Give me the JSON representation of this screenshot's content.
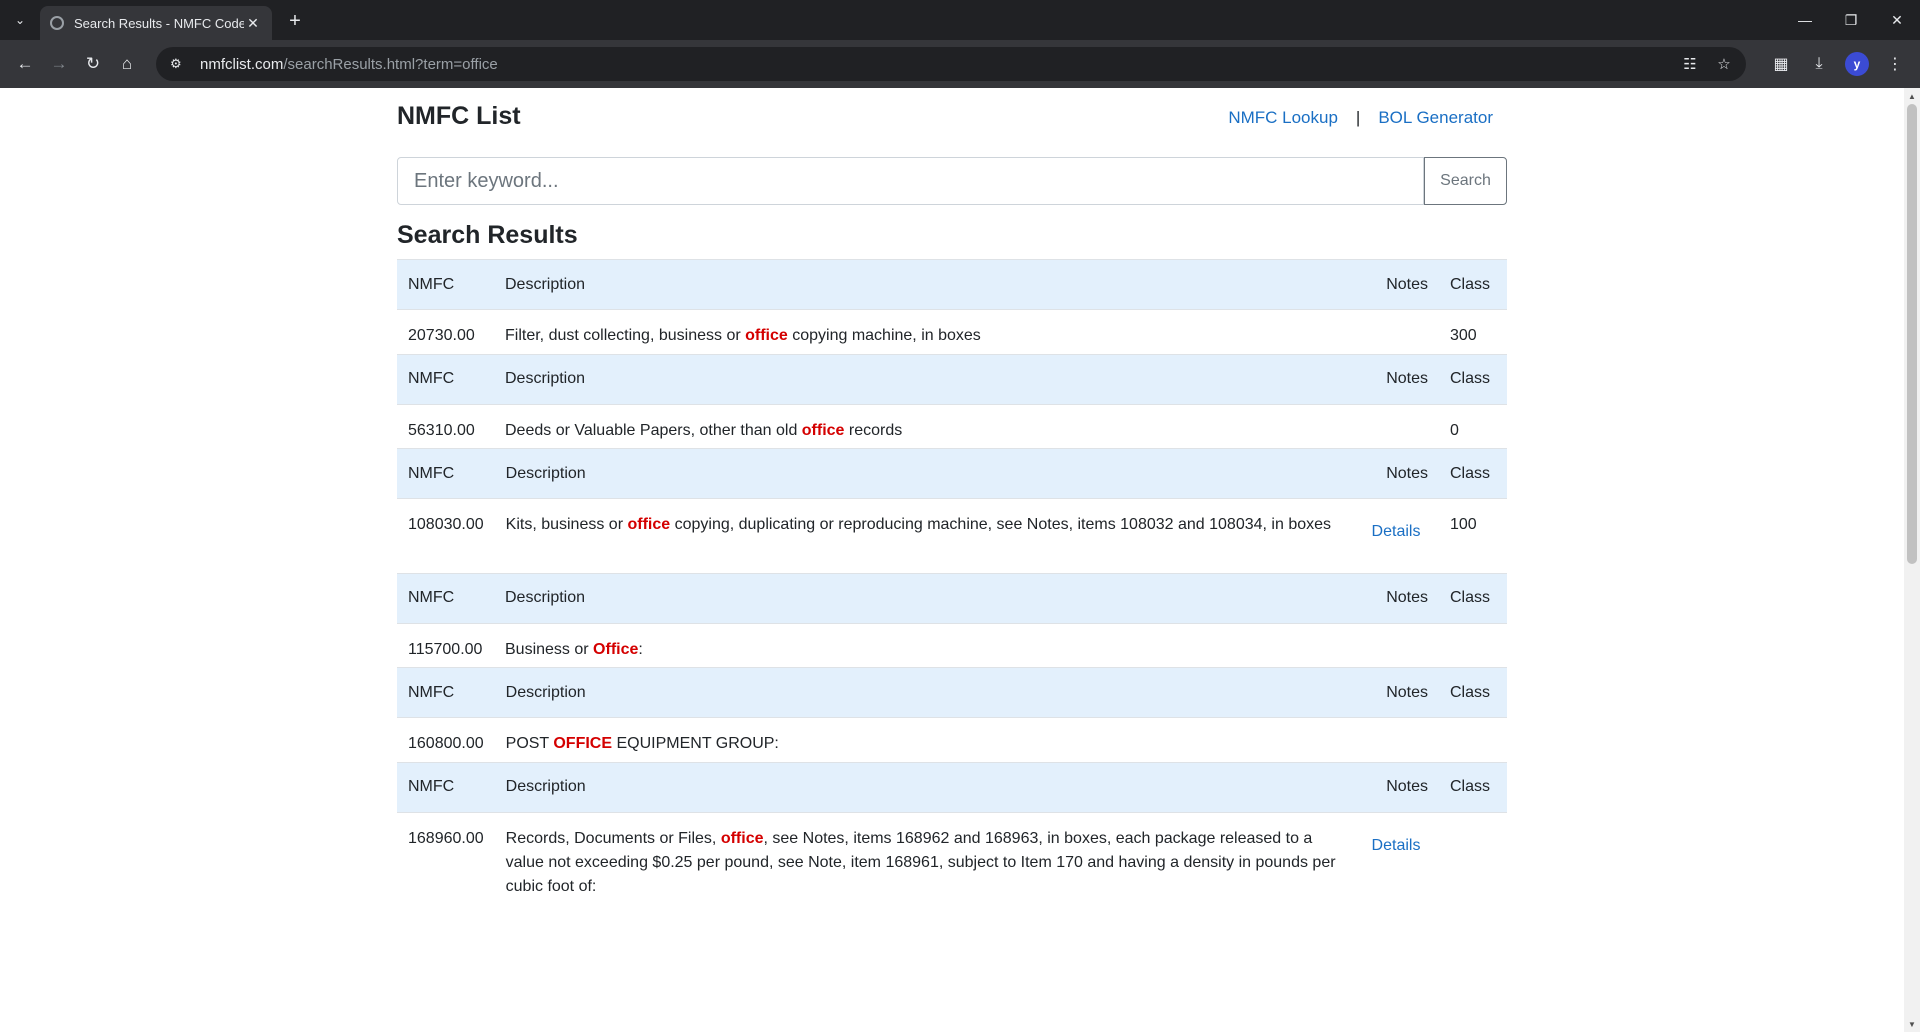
{
  "browser": {
    "tab_title": "Search Results - NMFC Code",
    "url_host": "nmfclist.com",
    "url_path": "/searchResults.html?term=office"
  },
  "header": {
    "brand": "NMFC List",
    "nav": [
      {
        "label": "NMFC Lookup"
      },
      {
        "label": "BOL Generator"
      }
    ],
    "separator": "|"
  },
  "search": {
    "placeholder": "Enter keyword...",
    "value": "",
    "button": "Search"
  },
  "results_title": "Search Results",
  "columns": {
    "nmfc": "NMFC",
    "description": "Description",
    "notes": "Notes",
    "class": "Class"
  },
  "results": [
    {
      "nmfc": "20730.00",
      "pre": "Filter, dust collecting, business or ",
      "hl": "office",
      "post": " copying machine, in boxes",
      "notes": "",
      "class": "300"
    },
    {
      "nmfc": "56310.00",
      "pre": "Deeds or Valuable Papers, other than old ",
      "hl": "office",
      "post": " records",
      "notes": "",
      "class": "0"
    },
    {
      "nmfc": "108030.00",
      "pre": "Kits, business or ",
      "hl": "office",
      "post": " copying, duplicating or reproducing machine, see Notes, items 108032 and 108034, in boxes",
      "notes": "Details",
      "class": "100"
    },
    {
      "nmfc": "115700.00",
      "pre": "Business or ",
      "hl": "Office",
      "post": ":",
      "notes": "",
      "class": ""
    },
    {
      "nmfc": "160800.00",
      "pre": "POST ",
      "hl": "OFFICE",
      "post": " EQUIPMENT GROUP:",
      "notes": "",
      "class": ""
    },
    {
      "nmfc": "168960.00",
      "pre": "Records, Documents or Files, ",
      "hl": "office",
      "post": ", see Notes, items 168962 and 168963, in boxes, each package released to a value not exceeding $0.25 per pound, see Note, item 168961, subject to Item 170 and having a density in pounds per cubic foot of:",
      "notes": "Details",
      "class": ""
    }
  ]
}
